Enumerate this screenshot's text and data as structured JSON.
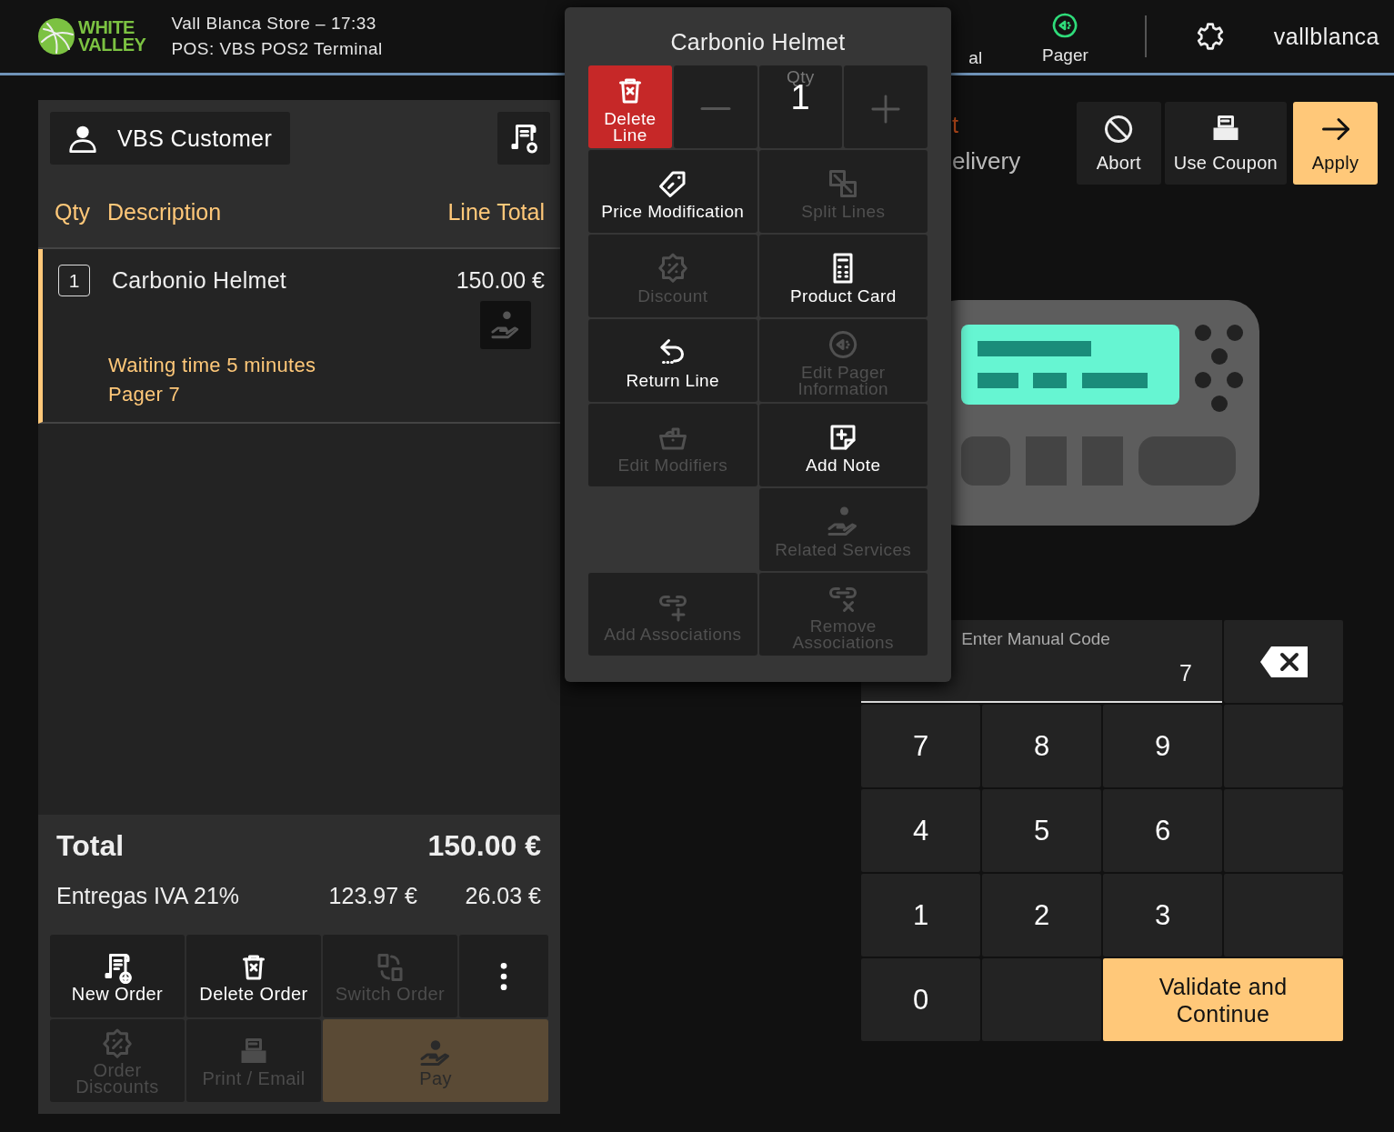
{
  "header": {
    "logo_line_1": "WHITE",
    "logo_line_2": "VALLEY",
    "store": "Vall Blanca Store – 17:33",
    "terminal": "POS: VBS POS2 Terminal",
    "nav": [
      {
        "kind": "cut",
        "label": "al"
      },
      {
        "kind": "pager",
        "label": "Pager"
      }
    ],
    "user": "vallblanca"
  },
  "order": {
    "customer": "VBS Customer",
    "columns": [
      "Qty",
      "Description",
      "Line Total"
    ],
    "lines": [
      {
        "qty": "1",
        "name": "Carbonio Helmet",
        "total": "150.00 €",
        "selected": true,
        "notes": [
          "Waiting time 5 minutes",
          "Pager 7"
        ]
      }
    ],
    "total_label": "Total",
    "total": "150.00 €",
    "taxes": [
      {
        "name": "Entregas IVA 21%",
        "base": "123.97 €",
        "amount": "26.03 €"
      }
    ],
    "actions": [
      {
        "kind": "new",
        "label": "New Order",
        "disabled": false
      },
      {
        "kind": "delete",
        "label": "Delete Order",
        "disabled": false
      },
      {
        "kind": "switch",
        "label": "Switch Order",
        "disabled": true
      },
      {
        "kind": "more",
        "disabled": false
      },
      {
        "kind": "discount",
        "label": "Order Discounts",
        "disabled": true
      },
      {
        "kind": "print",
        "label": "Print / Email",
        "disabled": true
      },
      {
        "kind": "pay",
        "label": "Pay",
        "disabled": true
      }
    ]
  },
  "popup": {
    "title": "Carbonio Helmet",
    "delete_label": "Delete Line",
    "qty_label": "Qty",
    "qty": "1",
    "actions": [
      {
        "kind": "price",
        "label": "Price Modification",
        "disabled": false
      },
      {
        "kind": "split",
        "label": "Split Lines",
        "disabled": true
      },
      {
        "kind": "discount",
        "label": "Discount",
        "disabled": true
      },
      {
        "kind": "card",
        "label": "Product Card",
        "disabled": false
      },
      {
        "kind": "return",
        "label": "Return Line",
        "disabled": false
      },
      {
        "kind": "pager",
        "label": "Edit Pager Information",
        "disabled": true
      },
      {
        "kind": "modifiers",
        "label": "Edit Modifiers",
        "disabled": true
      },
      {
        "kind": "note",
        "label": "Add Note",
        "disabled": false
      },
      {
        "kind": "spacer"
      },
      {
        "kind": "services",
        "label": "Related Services",
        "disabled": true
      },
      {
        "kind": "link_add",
        "label": "Add Associations",
        "disabled": true
      },
      {
        "kind": "link_remove",
        "label": "Remove Associations",
        "disabled": true
      }
    ]
  },
  "discount_panel": {
    "title": "t",
    "subtitle": "elivery",
    "buttons": [
      {
        "kind": "abort",
        "label": "Abort"
      },
      {
        "kind": "coupon",
        "label": "Use Coupon"
      },
      {
        "kind": "apply",
        "label": "Apply"
      }
    ]
  },
  "keypad": {
    "label": "Enter Manual Code",
    "value": "7",
    "keys": [
      {
        "kind": "digit",
        "label": "7"
      },
      {
        "kind": "digit",
        "label": "8"
      },
      {
        "kind": "digit",
        "label": "9"
      },
      {
        "kind": "blank"
      },
      {
        "kind": "digit",
        "label": "4"
      },
      {
        "kind": "digit",
        "label": "5"
      },
      {
        "kind": "digit",
        "label": "6"
      },
      {
        "kind": "blank"
      },
      {
        "kind": "digit",
        "label": "1"
      },
      {
        "kind": "digit",
        "label": "2"
      },
      {
        "kind": "digit",
        "label": "3"
      },
      {
        "kind": "blank"
      },
      {
        "kind": "digit",
        "label": "0"
      },
      {
        "kind": "blank"
      },
      {
        "kind": "confirm",
        "label": "Validate and Continue"
      }
    ]
  }
}
